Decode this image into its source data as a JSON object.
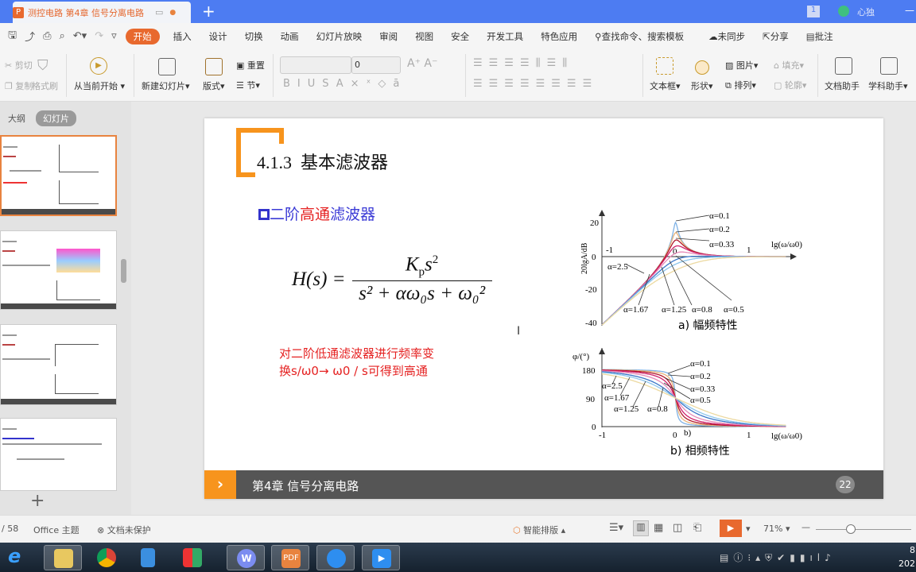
{
  "titlebar": {
    "doc_title": "测控电路 第4章 信号分离电路",
    "new_tab": "+",
    "badge": "1",
    "user": "心独",
    "minimize": "—"
  },
  "menubar": {
    "items": [
      "开始",
      "插入",
      "设计",
      "切换",
      "动画",
      "幻灯片放映",
      "审阅",
      "视图",
      "安全",
      "开发工具",
      "特色应用"
    ],
    "search": "查找命令、搜索模板",
    "sync": "未同步",
    "share": "分享",
    "comment": "批注"
  },
  "ribbon": {
    "cut": "剪切",
    "copy": "复制",
    "format_painter": "格式刷",
    "from_current": "从当前开始",
    "new_slide": "新建幻灯片",
    "layout": "版式",
    "reset": "重置",
    "section": "节",
    "font_name": "",
    "font_size": "0",
    "textbox": "文本框",
    "shape": "形状",
    "picture": "图片",
    "arrange": "排列",
    "fill": "填充",
    "outline": "轮廓",
    "doc_assistant": "文档助手",
    "subject_assistant": "学科助手"
  },
  "leftpane": {
    "tabs": [
      "大纲",
      "幻灯片"
    ],
    "add": "+"
  },
  "slide": {
    "heading": "4.1.3  基本滤波器",
    "subtitle_parts": [
      "二阶",
      "高通",
      "滤波器"
    ],
    "formula": {
      "lhs": "H(s) =",
      "num_K": "K",
      "num_p": "p",
      "num_s": "s",
      "num_exp": "2",
      "den": "s² + αω₀s + ω₀²"
    },
    "note_line1": "对二阶低通滤波器进行频率变",
    "note_line2": "换s/ω0→ ω0 / s可得到高通",
    "footer": "第4章 信号分离电路",
    "page_number": "22",
    "accent": "#f7941d"
  },
  "chart_data": [
    {
      "type": "line",
      "title": "a) 幅频特性",
      "xlabel": "lg(ω/ω0)",
      "ylabel": "20lgA/dB",
      "xlim": [
        -1,
        1.5
      ],
      "ylim": [
        -40,
        20
      ],
      "xticks": [
        "-1",
        "0",
        "1"
      ],
      "yticks": [
        "20",
        "0",
        "-20",
        "-40"
      ],
      "series": [
        {
          "name": "α=0.1",
          "alpha": 0.1,
          "color": "#7fb2e6"
        },
        {
          "name": "α=0.2",
          "alpha": 0.2,
          "color": "#e8b27a"
        },
        {
          "name": "α=0.33",
          "alpha": 0.33,
          "color": "#b0182b"
        },
        {
          "name": "α=0.5",
          "alpha": 0.5,
          "color": "#d0206a"
        },
        {
          "name": "α=0.8",
          "alpha": 0.8,
          "color": "#e58ab8"
        },
        {
          "name": "α=1.25",
          "alpha": 1.25,
          "color": "#3a76c8"
        },
        {
          "name": "α=1.67",
          "alpha": 1.67,
          "color": "#8cc6ec"
        },
        {
          "name": "α=2.5",
          "alpha": 2.5,
          "color": "#ecd9a0"
        }
      ]
    },
    {
      "type": "line",
      "title": "b) 相频特性",
      "xlabel": "lg(ω/ω0)",
      "ylabel": "φ/(°)",
      "xlim": [
        -1,
        1.5
      ],
      "ylim": [
        0,
        180
      ],
      "xticks": [
        "-1",
        "0",
        "1"
      ],
      "yticks": [
        "180",
        "90",
        "0"
      ],
      "mark": "b)",
      "series": [
        {
          "name": "α=0.1",
          "alpha": 0.1
        },
        {
          "name": "α=0.2",
          "alpha": 0.2
        },
        {
          "name": "α=0.33",
          "alpha": 0.33
        },
        {
          "name": "α=0.5",
          "alpha": 0.5
        },
        {
          "name": "α=0.8",
          "alpha": 0.8
        },
        {
          "name": "α=1.25",
          "alpha": 1.25
        },
        {
          "name": "α=1.67",
          "alpha": 1.67
        },
        {
          "name": "α=2.5",
          "alpha": 2.5
        }
      ]
    }
  ],
  "statusbar": {
    "page": "/ 58",
    "theme": "Office 主题",
    "protect": "文档未保护",
    "smart": "智能排版",
    "zoom": "71%"
  },
  "taskbar": {
    "clock1": "8",
    "clock2": "202"
  }
}
